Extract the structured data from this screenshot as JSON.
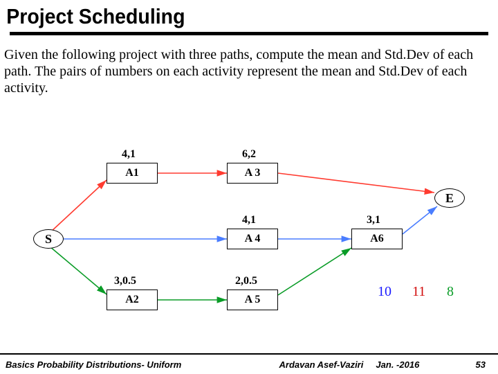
{
  "title": "Project Scheduling",
  "paragraph": "Given the following project with three paths, compute the mean and Std.Dev of each path.  The pairs of numbers on each activity represent the mean and Std.Dev of each activity.",
  "nodes": {
    "S": "S",
    "A1": "A1",
    "A2": "A2",
    "A3": "A 3",
    "A4": "A 4",
    "A5": "A 5",
    "A6": "A6",
    "E": "E"
  },
  "edge_labels": {
    "a1": "4,1",
    "a3": "6,2",
    "a4": "4,1",
    "a6": "3,1",
    "a2": "3,0.5",
    "a5": "2,0.5"
  },
  "answers": {
    "blue": "10",
    "red": "11",
    "green": "8"
  },
  "colors": {
    "red": "#d10a0a",
    "blue": "#1a1aff",
    "green": "#0a9c27",
    "arrow_blue": "#4a7dff",
    "arrow_red": "#ff3b30"
  },
  "footer": {
    "left": "Basics Probability Distributions- Uniform",
    "author": "Ardavan Asef-Vaziri",
    "date": "Jan. -2016",
    "page": "53"
  }
}
